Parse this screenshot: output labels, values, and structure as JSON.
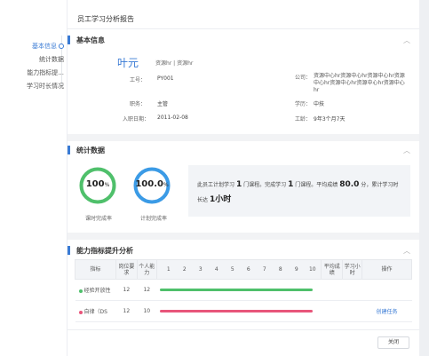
{
  "page": {
    "title": "员工学习分析报告"
  },
  "sidebar": {
    "items": [
      {
        "label": "基本信息",
        "active": true
      },
      {
        "label": "统计数据",
        "active": false
      },
      {
        "label": "能力指标提...",
        "active": false
      },
      {
        "label": "学习时长情况",
        "active": false
      }
    ]
  },
  "basic": {
    "section_title": "基本信息",
    "name": "叶元",
    "tags": "资源hr | 资源hr",
    "fields": {
      "employee_no_label": "工号：",
      "employee_no": "PY001",
      "company_label": "公司：",
      "company": "资源中心hr资源中心hr资源中心hr资源中心hr资源中心hr资源中心hr资源中心hr",
      "position_label": "职务：",
      "position": "主管",
      "education_label": "学历：",
      "education": "中技",
      "join_date_label": "入职日期：",
      "join_date": "2011-02-08",
      "seniority_label": "工龄：",
      "seniority": "9年3个月7天"
    }
  },
  "stats": {
    "section_title": "统计数据",
    "gauges": [
      {
        "value": "100",
        "unit": "%",
        "caption": "课时完成率",
        "color": "#4fc06b",
        "fraction": 1.0
      },
      {
        "value": "100.0",
        "unit": "%",
        "caption": "计划完成率",
        "color": "#3b9be6",
        "fraction": 1.0
      }
    ],
    "summary": {
      "p1": "此员工计划学习",
      "planned": "1",
      "p2": "门课程。完成学习",
      "completed": "1",
      "p3": "门课程。平均成绩",
      "avg_score": "80.0",
      "p4": "分，累计学习时长达",
      "duration": "1小时"
    }
  },
  "ability": {
    "section_title": "能力指标提升分析",
    "headers": {
      "indicator": "指标",
      "post_req": "岗位要求",
      "personal": "个人能力",
      "avg_score": "平均成绩",
      "study_hours": "学习小时",
      "ops": "操作"
    },
    "scale": [
      "1",
      "2",
      "3",
      "4",
      "5",
      "6",
      "7",
      "8",
      "9",
      "10"
    ],
    "rows": [
      {
        "name": "经验开放性",
        "post_req": "12",
        "personal": "12",
        "bar_color": "#4fc06b",
        "fraction": 1.0,
        "op": ""
      },
      {
        "name": "自律（DS",
        "post_req": "12",
        "personal": "10",
        "bar_color": "#e8557a",
        "fraction": 1.0,
        "op": "创建任务"
      }
    ]
  },
  "footer": {
    "close_label": "关闭"
  },
  "colors": {
    "accent": "#3a7bd5",
    "green": "#4fc06b",
    "blue": "#3b9be6",
    "pink": "#e8557a"
  }
}
